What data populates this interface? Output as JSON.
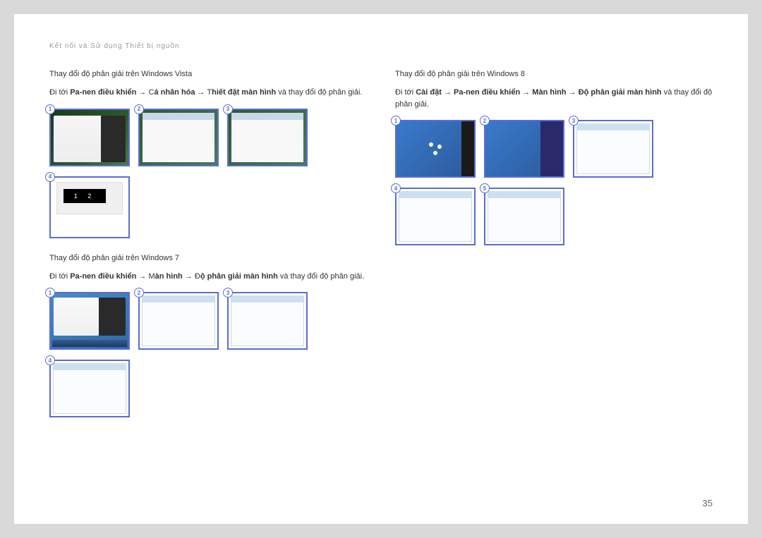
{
  "header": "Kết nối và Sử dụng Thiết bị nguồn",
  "page_number": "35",
  "vista": {
    "title": "Thay đổi độ phân giải trên Windows Vista",
    "body_prefix": "Đi tới ",
    "path1": "Pa-nen điều khiển",
    "arrow": " → ",
    "path2_prefix": "C",
    "path2": "á nhân hóa",
    "path3_prefix": " → T",
    "path3": "hiết đặt màn hình",
    "body_suffix": " và thay đổi độ phân giải.",
    "badges": [
      "1",
      "2",
      "3",
      "4"
    ]
  },
  "win7": {
    "title": "Thay đổi độ phân giải trên Windows 7",
    "body_prefix": "Đi tới ",
    "path1": "Pa-nen điều khiển",
    "arrow": " → ",
    "path2_prefix": "M",
    "path2": "àn hình",
    "path3_prefix": " → Đ",
    "path3": "ộ phân giải màn hình",
    "body_suffix": " và thay đổi độ phân giải.",
    "badges": [
      "1",
      "2",
      "3",
      "4"
    ]
  },
  "win8": {
    "title": "Thay đổi độ phân giải trên Windows 8",
    "body_prefix": "Đi tới ",
    "path1": "Cài đặt",
    "arrow": " → ",
    "path2": "Pa-nen điều khiển",
    "path3": "Màn hình",
    "path4": "Độ phân giải màn hình",
    "body_suffix": " và thay đổi độ phân giải.",
    "badges": [
      "1",
      "2",
      "3",
      "4",
      "5"
    ]
  }
}
